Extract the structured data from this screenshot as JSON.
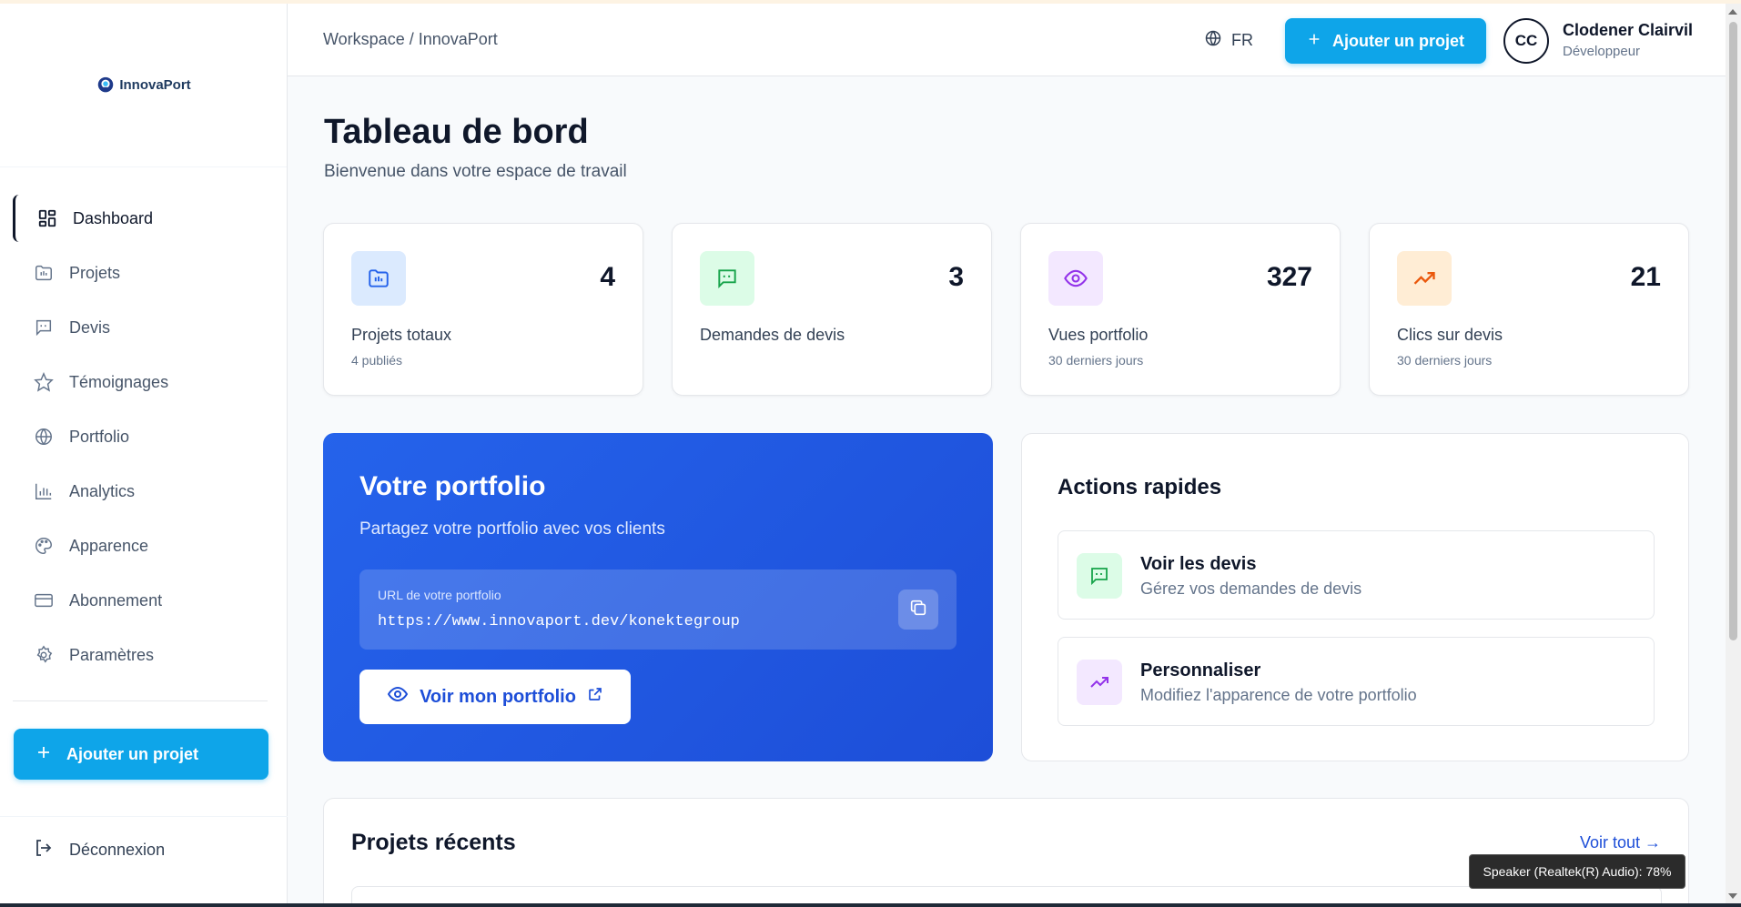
{
  "app": {
    "name": "InnovaPort"
  },
  "sidebar": {
    "items": [
      {
        "label": "Dashboard",
        "icon": "layout-grid-icon",
        "active": true
      },
      {
        "label": "Projets",
        "icon": "folder-icon"
      },
      {
        "label": "Devis",
        "icon": "message-quote-icon"
      },
      {
        "label": "Témoignages",
        "icon": "star-icon"
      },
      {
        "label": "Portfolio",
        "icon": "globe-icon"
      },
      {
        "label": "Analytics",
        "icon": "bar-chart-icon"
      },
      {
        "label": "Apparence",
        "icon": "palette-icon"
      },
      {
        "label": "Abonnement",
        "icon": "credit-card-icon"
      },
      {
        "label": "Paramètres",
        "icon": "gear-icon"
      }
    ],
    "add_project": "Ajouter un projet",
    "logout": "Déconnexion"
  },
  "header": {
    "breadcrumb": "Workspace / InnovaPort",
    "language": "FR",
    "add_project": "Ajouter un projet",
    "user": {
      "initials": "CC",
      "name": "Clodener Clairvil",
      "role": "Développeur"
    }
  },
  "main": {
    "title": "Tableau de bord",
    "subtitle": "Bienvenue dans votre espace de travail",
    "stats": [
      {
        "value": "4",
        "label": "Projets totaux",
        "sub": "4 publiés",
        "icon": "folder-icon",
        "color": "#2563eb",
        "bg": "#dbeafe"
      },
      {
        "value": "3",
        "label": "Demandes de devis",
        "sub": "",
        "icon": "message-quote-icon",
        "color": "#16a34a",
        "bg": "#dcfce7"
      },
      {
        "value": "327",
        "label": "Vues portfolio",
        "sub": "30 derniers jours",
        "icon": "eye-icon",
        "color": "#9333ea",
        "bg": "#f3e8ff"
      },
      {
        "value": "21",
        "label": "Clics sur devis",
        "sub": "30 derniers jours",
        "icon": "trending-up-icon",
        "color": "#ea580c",
        "bg": "#ffedd5"
      }
    ],
    "portfolio": {
      "title": "Votre portfolio",
      "subtitle": "Partagez votre portfolio avec vos clients",
      "url_label": "URL de votre portfolio",
      "url": "https://www.innovaport.dev/konektegroup",
      "view_button": "Voir mon portfolio"
    },
    "quick_actions": {
      "title": "Actions rapides",
      "items": [
        {
          "title": "Voir les devis",
          "description": "Gérez vos demandes de devis",
          "icon": "message-quote-icon",
          "color": "#16a34a",
          "bg": "#dcfce7"
        },
        {
          "title": "Personnaliser",
          "description": "Modifiez l'apparence de votre portfolio",
          "icon": "trending-up-icon",
          "color": "#9333ea",
          "bg": "#f3e8ff"
        }
      ]
    },
    "recent_projects": {
      "title": "Projets récents",
      "view_all": "Voir tout →"
    }
  },
  "system": {
    "tooltip": "Speaker (Realtek(R) Audio): 78%"
  }
}
